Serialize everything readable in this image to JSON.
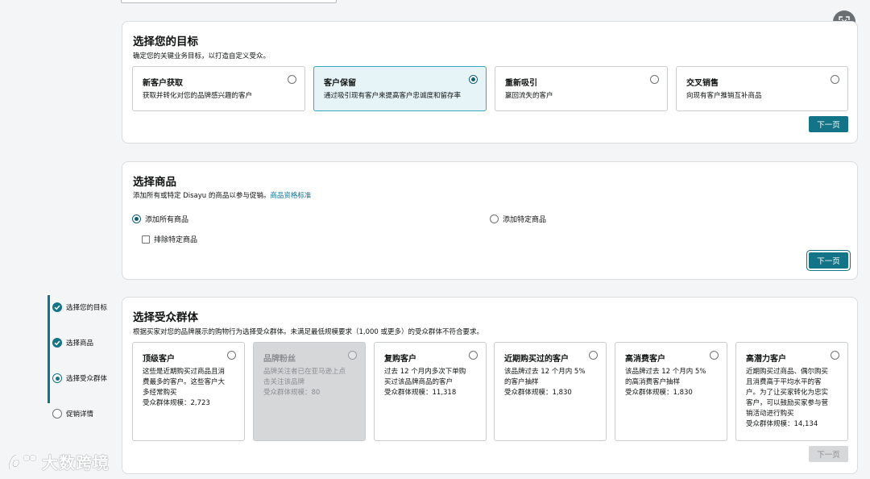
{
  "goal": {
    "title": "选择您的目标",
    "subtitle": "确定您的关键业务目标，以打造自定义受众。",
    "options": [
      {
        "title": "新客户获取",
        "desc": "获取并转化对您的品牌感兴趣的客户",
        "selected": false
      },
      {
        "title": "客户保留",
        "desc": "通过吸引现有客户来提高客户忠诚度和留存率",
        "selected": true
      },
      {
        "title": "重新吸引",
        "desc": "赢回流失的客户",
        "selected": false
      },
      {
        "title": "交叉销售",
        "desc": "向现有客户推销互补商品",
        "selected": false
      }
    ],
    "next_label": "下一页"
  },
  "products": {
    "title": "选择商品",
    "subtitle": "添加所有或特定 Disayu 的商品以参与促销。",
    "subtitle_link": "商品资格标准",
    "add_all_label": "添加所有商品",
    "add_specific_label": "添加特定商品",
    "exclude_label": "排除特定商品",
    "next_label": "下一页"
  },
  "audience": {
    "title": "选择受众群体",
    "subtitle": "根据买家对您的品牌展示的购物行为选择受众群体。未满足最低规模要求（1,000 或更多）的受众群体不符合要求。",
    "options": [
      {
        "title": "顶级客户",
        "desc": [
          "这些是近期购买过商品且消",
          "费最多的客户。这些客户大",
          "多经常购买"
        ],
        "size": "受众群体规模：2,723",
        "disabled": false
      },
      {
        "title": "品牌粉丝",
        "desc": [
          "品牌关注者已在亚马逊上点",
          "击关注该品牌"
        ],
        "size": "受众群体规模：80",
        "disabled": true
      },
      {
        "title": "复购客户",
        "desc": [
          "过去 12 个月内多次下单购",
          "买过该品牌商品的客户"
        ],
        "size": "受众群体规模：11,318",
        "disabled": false
      },
      {
        "title": "近期购买过的客户",
        "desc": [
          "该品牌过去 12 个月内 5%",
          "的客户抽样"
        ],
        "size": "受众群体规模：1,830",
        "disabled": false
      },
      {
        "title": "高消费客户",
        "desc": [
          "该品牌过去 12 个月内 5%",
          "的高消费客户抽样"
        ],
        "size": "受众群体规模：1,830",
        "disabled": false
      },
      {
        "title": "高潜力客户",
        "desc": [
          "近期购买过商品、偶尔购买",
          "且消费高于平均水平的客",
          "户。为了让买家转化为忠实",
          "客户，可以鼓励买家参与营",
          "销活动进行购买"
        ],
        "size": "受众群体规模：14,134",
        "disabled": false
      }
    ],
    "next_label": "下一页"
  },
  "steps": [
    {
      "label": "选择您的目标",
      "state": "done"
    },
    {
      "label": "选择商品",
      "state": "done"
    },
    {
      "label": "选择受众群体",
      "state": "current"
    },
    {
      "label": "促销详情",
      "state": "todo"
    }
  ],
  "watermark": "大数跨境",
  "icons": {
    "expand": "expand-icon",
    "check": "check-icon"
  },
  "colors": {
    "accent": "#137488",
    "selected_bg": "#e6f4f8",
    "selected_border": "#38a7bf"
  }
}
